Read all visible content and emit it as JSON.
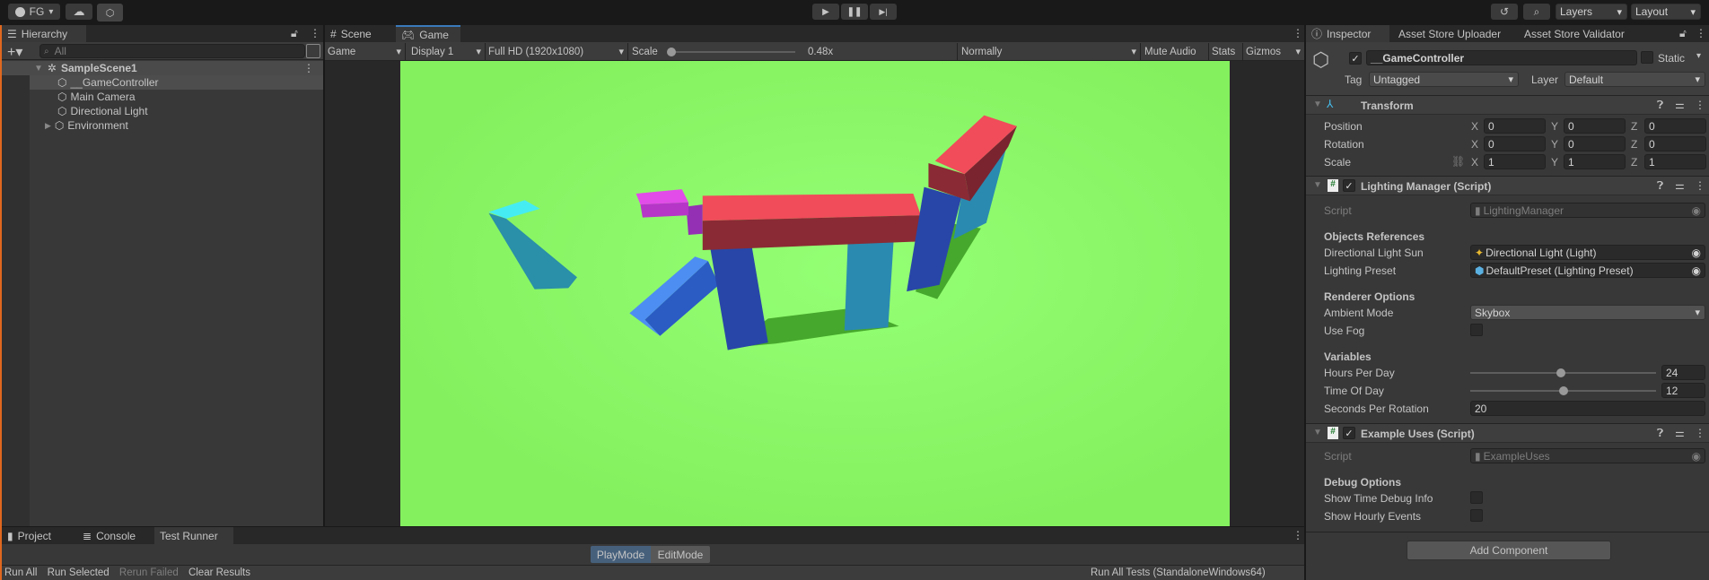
{
  "toolbar": {
    "account": "FG",
    "layers": "Layers",
    "layout": "Layout"
  },
  "hierarchy": {
    "title": "Hierarchy",
    "search_placeholder": "All",
    "scene": "SampleScene1",
    "items": [
      "__GameController",
      "Main Camera",
      "Directional Light",
      "Environment"
    ]
  },
  "game": {
    "tabs": [
      "Scene",
      "Game"
    ],
    "view_mode": "Game",
    "display": "Display 1",
    "resolution": "Full HD (1920x1080)",
    "scale_label": "Scale",
    "scale_value": "0.48x",
    "play_focus": "Normally",
    "mute_audio": "Mute Audio",
    "stats": "Stats",
    "gizmos": "Gizmos",
    "view_bg": "#86f562"
  },
  "bottom": {
    "tabs": [
      "Project",
      "Console",
      "Test Runner"
    ],
    "modes": [
      "PlayMode",
      "EditMode"
    ],
    "actions": [
      "Run All",
      "Run Selected",
      "Rerun Failed",
      "Clear Results"
    ],
    "run_target": "Run All Tests (StandaloneWindows64)"
  },
  "inspector": {
    "tabs": [
      "Inspector",
      "Asset Store Uploader",
      "Asset Store Validator"
    ],
    "object_name": "__GameController",
    "static_label": "Static",
    "tag_label": "Tag",
    "tag": "Untagged",
    "layer_label": "Layer",
    "layer": "Default",
    "transform": {
      "title": "Transform",
      "rows": [
        {
          "label": "Position",
          "x": "0",
          "y": "0",
          "z": "0"
        },
        {
          "label": "Rotation",
          "x": "0",
          "y": "0",
          "z": "0"
        },
        {
          "label": "Scale",
          "x": "1",
          "y": "1",
          "z": "1"
        }
      ],
      "axes": [
        "X",
        "Y",
        "Z"
      ]
    },
    "lighting": {
      "title": "Lighting Manager (Script)",
      "script_label": "Script",
      "script": "LightingManager",
      "sec_refs": "Objects References",
      "sun_label": "Directional Light Sun",
      "sun": "Directional Light (Light)",
      "preset_label": "Lighting Preset",
      "preset": "DefaultPreset (Lighting Preset)",
      "sec_renderer": "Renderer Options",
      "ambient_label": "Ambient Mode",
      "ambient": "Skybox",
      "fog_label": "Use Fog",
      "fog": false,
      "sec_vars": "Variables",
      "hours_label": "Hours Per Day",
      "hours": "24",
      "hours_fraction": 0.49,
      "time_label": "Time Of Day",
      "time": "12",
      "time_fraction": 0.5,
      "seconds_label": "Seconds Per Rotation",
      "seconds": "20"
    },
    "example": {
      "title": "Example Uses (Script)",
      "script_label": "Script",
      "script": "ExampleUses",
      "sec_debug": "Debug Options",
      "time_debug_label": "Show Time Debug Info",
      "hourly_label": "Show Hourly Events"
    },
    "add_component": "Add Component"
  }
}
